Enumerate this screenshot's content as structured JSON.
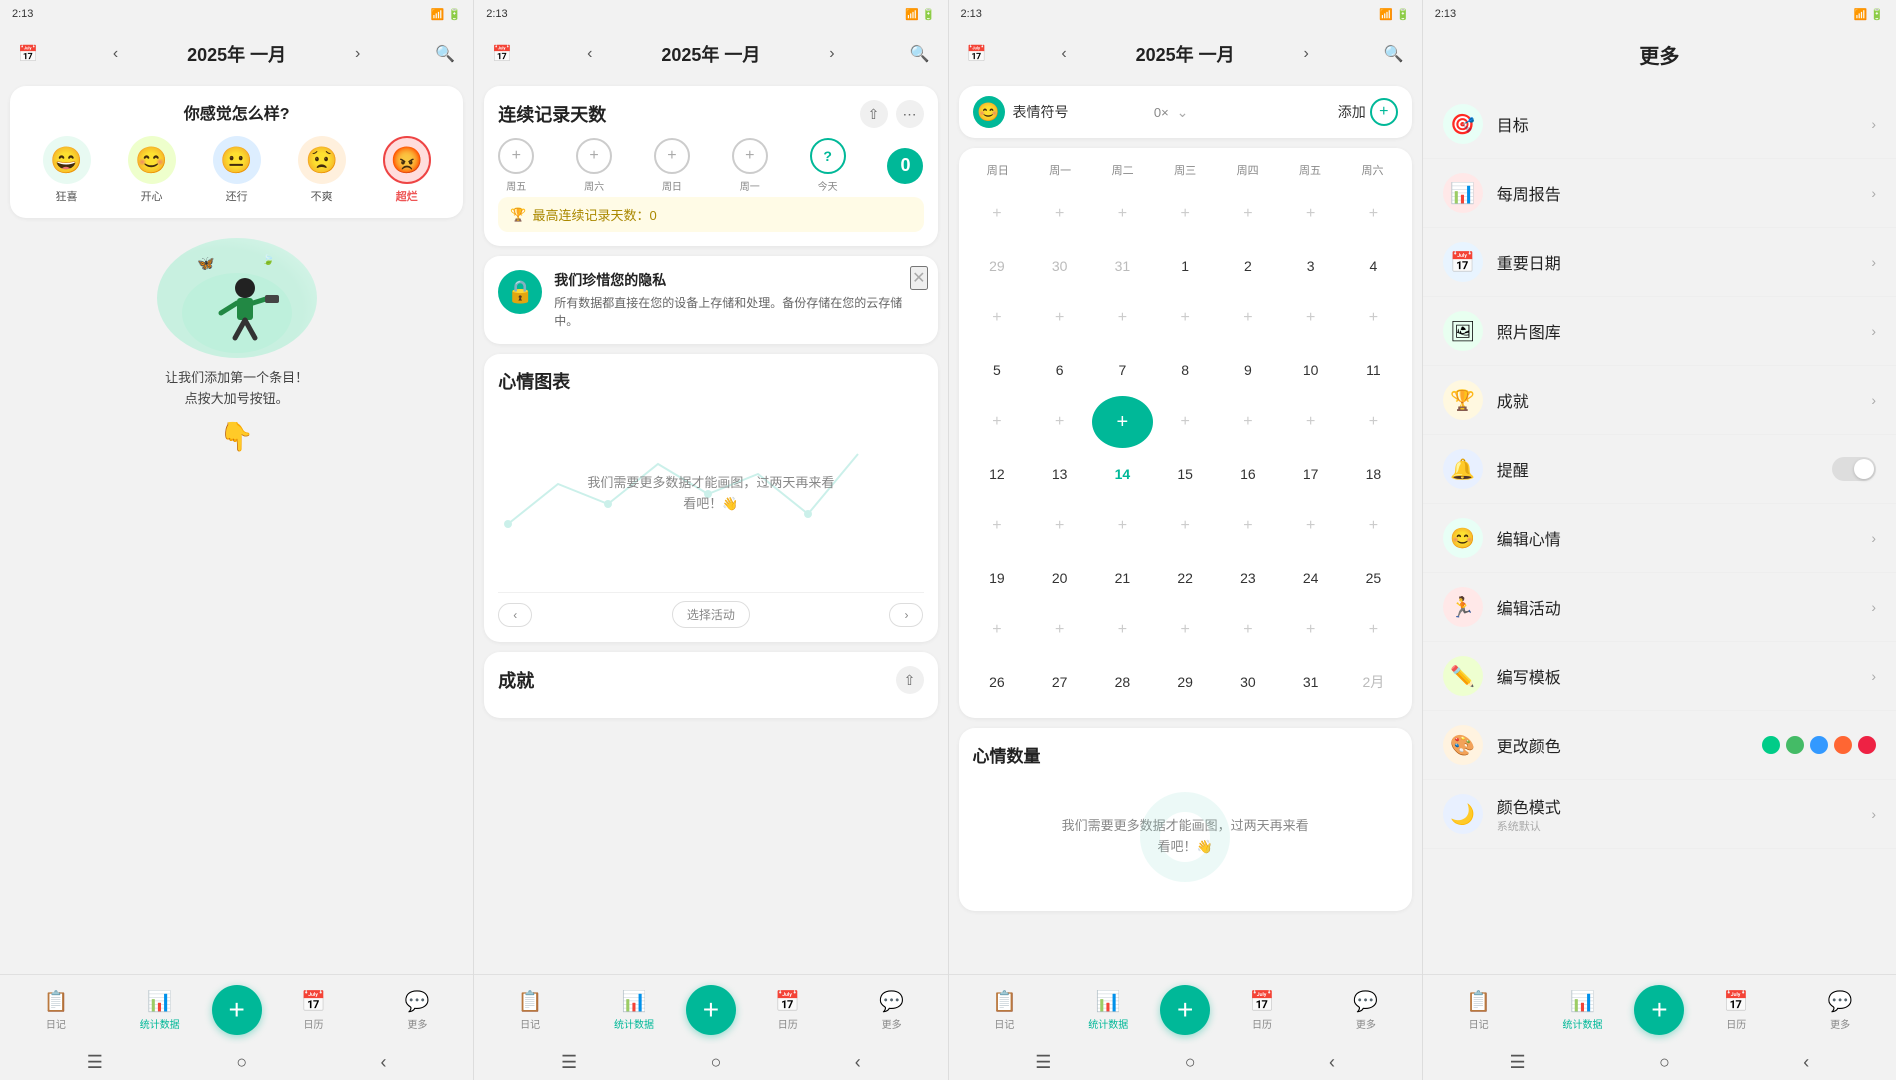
{
  "statusBar": {
    "time": "2:13",
    "icons": "signal wifi battery"
  },
  "panel1": {
    "header": {
      "title": "2025年 一月",
      "prevBtn": "‹",
      "nextBtn": "›",
      "calBtn": "📅",
      "searchBtn": "🔍"
    },
    "moodCard": {
      "question": "你感觉怎么样?",
      "moods": [
        {
          "label": "狂喜",
          "emoji": "😄",
          "color": "#4ccc88",
          "selected": false
        },
        {
          "label": "开心",
          "emoji": "😊",
          "color": "#88cc44",
          "selected": false
        },
        {
          "label": "还行",
          "emoji": "😐",
          "color": "#88aadd",
          "selected": false
        },
        {
          "label": "不爽",
          "emoji": "😟",
          "color": "#ffaa44",
          "selected": false
        },
        {
          "label": "超烂",
          "emoji": "😡",
          "color": "#ee4444",
          "selected": true
        }
      ]
    },
    "illustrationText": "让我们添加第一个条目！\n点按大加号按钮。",
    "arrowEmoji": "👇"
  },
  "panel2": {
    "header": {
      "title": "2025年 一月"
    },
    "streakCard": {
      "title": "连续记录天数",
      "days": [
        {
          "label": "周五",
          "type": "add"
        },
        {
          "label": "周六",
          "type": "add"
        },
        {
          "label": "周日",
          "type": "add"
        },
        {
          "label": "周一",
          "type": "add"
        },
        {
          "label": "今天",
          "type": "today"
        },
        {
          "label": "",
          "type": "count",
          "value": "0"
        }
      ],
      "bestLabel": "最高连续记录天数：0"
    },
    "privacyCard": {
      "title": "我们珍惜您的隐私",
      "body": "所有数据都直接在您的设备上存储和处理。备份存储在您的云存储中。"
    },
    "chartCard": {
      "title": "心情图表",
      "overlayText": "我们需要更多数据才能画图，过两天再来看\n看吧！👋",
      "filterLabel": "选择活动"
    },
    "achieveCard": {
      "title": "成就"
    }
  },
  "panel3": {
    "header": {
      "title": "2025年 一月"
    },
    "emojiSelector": {
      "label": "表情符号",
      "count": "0×",
      "addLabel": "添加"
    },
    "calendar": {
      "weekdays": [
        "周日",
        "周一",
        "周二",
        "周三",
        "周四",
        "周五",
        "周六"
      ],
      "rows": [
        [
          {
            "date": "",
            "type": "add"
          },
          {
            "date": "",
            "type": "add"
          },
          {
            "date": "",
            "type": "add"
          },
          {
            "date": "",
            "type": "add"
          },
          {
            "date": "",
            "type": "add"
          },
          {
            "date": "",
            "type": "add"
          },
          {
            "date": "",
            "type": "add"
          }
        ],
        [
          {
            "date": "29",
            "type": "prevMonth"
          },
          {
            "date": "30",
            "type": "prevMonth"
          },
          {
            "date": "31",
            "type": "prevMonth"
          },
          {
            "date": "1",
            "type": "normal"
          },
          {
            "date": "2",
            "type": "normal"
          },
          {
            "date": "3",
            "type": "normal"
          },
          {
            "date": "4",
            "type": "normal"
          }
        ],
        [
          {
            "date": "",
            "type": "add"
          },
          {
            "date": "",
            "type": "add"
          },
          {
            "date": "",
            "type": "add"
          },
          {
            "date": "",
            "type": "add"
          },
          {
            "date": "",
            "type": "add"
          },
          {
            "date": "",
            "type": "add"
          },
          {
            "date": "",
            "type": "add"
          }
        ],
        [
          {
            "date": "5",
            "type": "normal"
          },
          {
            "date": "6",
            "type": "normal"
          },
          {
            "date": "7",
            "type": "normal"
          },
          {
            "date": "8",
            "type": "normal"
          },
          {
            "date": "9",
            "type": "normal"
          },
          {
            "date": "10",
            "type": "normal"
          },
          {
            "date": "11",
            "type": "normal"
          }
        ],
        [
          {
            "date": "",
            "type": "add"
          },
          {
            "date": "",
            "type": "add"
          },
          {
            "date": "14",
            "type": "today"
          },
          {
            "date": "",
            "type": "add"
          },
          {
            "date": "",
            "type": "add"
          },
          {
            "date": "",
            "type": "add"
          },
          {
            "date": "",
            "type": "add"
          }
        ],
        [
          {
            "date": "12",
            "type": "normal"
          },
          {
            "date": "13",
            "type": "normal"
          },
          {
            "date": "14",
            "type": "normal-shown"
          },
          {
            "date": "15",
            "type": "normal"
          },
          {
            "date": "16",
            "type": "normal"
          },
          {
            "date": "17",
            "type": "normal"
          },
          {
            "date": "18",
            "type": "normal"
          }
        ],
        [
          {
            "date": "",
            "type": "add"
          },
          {
            "date": "",
            "type": "add"
          },
          {
            "date": "",
            "type": "add"
          },
          {
            "date": "",
            "type": "add"
          },
          {
            "date": "",
            "type": "add"
          },
          {
            "date": "",
            "type": "add"
          },
          {
            "date": "",
            "type": "add"
          }
        ],
        [
          {
            "date": "19",
            "type": "normal"
          },
          {
            "date": "20",
            "type": "normal"
          },
          {
            "date": "21",
            "type": "normal"
          },
          {
            "date": "22",
            "type": "normal"
          },
          {
            "date": "23",
            "type": "normal"
          },
          {
            "date": "24",
            "type": "normal"
          },
          {
            "date": "25",
            "type": "normal"
          }
        ],
        [
          {
            "date": "",
            "type": "add"
          },
          {
            "date": "",
            "type": "add"
          },
          {
            "date": "",
            "type": "add"
          },
          {
            "date": "",
            "type": "add"
          },
          {
            "date": "",
            "type": "add"
          },
          {
            "date": "",
            "type": "add"
          },
          {
            "date": "",
            "type": "add"
          }
        ],
        [
          {
            "date": "26",
            "type": "normal"
          },
          {
            "date": "27",
            "type": "normal"
          },
          {
            "date": "28",
            "type": "normal"
          },
          {
            "date": "29",
            "type": "normal"
          },
          {
            "date": "30",
            "type": "normal"
          },
          {
            "date": "31",
            "type": "normal"
          },
          {
            "date": "2月",
            "type": "nextMonth"
          }
        ]
      ]
    },
    "moodCountCard": {
      "title": "心情数量",
      "overlayText": "我们需要更多数据才能画图，过两天再来看\n看吧！👋"
    }
  },
  "panel4": {
    "title": "更多",
    "items": [
      {
        "label": "目标",
        "iconBg": "#00b898",
        "iconEmoji": "🎯"
      },
      {
        "label": "每周报告",
        "iconBg": "#e84444",
        "iconEmoji": "📊"
      },
      {
        "label": "重要日期",
        "iconBg": "#44aaee",
        "iconEmoji": "📅"
      },
      {
        "label": "照片图库",
        "iconBg": "#44cc88",
        "iconEmoji": "🖼"
      },
      {
        "label": "成就",
        "iconBg": "#ffaa22",
        "iconEmoji": "🏆"
      },
      {
        "label": "提醒",
        "iconBg": "#3388ff",
        "iconEmoji": "🔔",
        "hasToggle": true
      },
      {
        "label": "编辑心情",
        "iconBg": "#00cc88",
        "iconEmoji": "😊"
      },
      {
        "label": "编辑活动",
        "iconBg": "#ee4444",
        "iconEmoji": "🏃"
      },
      {
        "label": "编写模板",
        "iconBg": "#88cc22",
        "iconEmoji": "✏️"
      },
      {
        "label": "更改颜色",
        "iconBg": "#ffaa22",
        "iconEmoji": "🎨",
        "hasColorDots": true,
        "colors": [
          "#00cc88",
          "#44bb66",
          "#3399ff",
          "#ff6633",
          "#ee2244"
        ]
      },
      {
        "label": "颜色模式",
        "iconBg": "#4488ff",
        "iconEmoji": "🌙",
        "sublabel": "系统默认"
      }
    ],
    "nav": {
      "items": [
        "日记",
        "统计数据",
        "日历",
        "更多"
      ]
    }
  },
  "bottomNav": {
    "items": [
      {
        "label": "日记",
        "icon": "📋",
        "active": false
      },
      {
        "label": "统计数据",
        "icon": "📊",
        "active": true
      },
      {
        "label": "日历",
        "icon": "📅",
        "active": false
      },
      {
        "label": "更多",
        "icon": "💬",
        "active": false
      }
    ]
  }
}
